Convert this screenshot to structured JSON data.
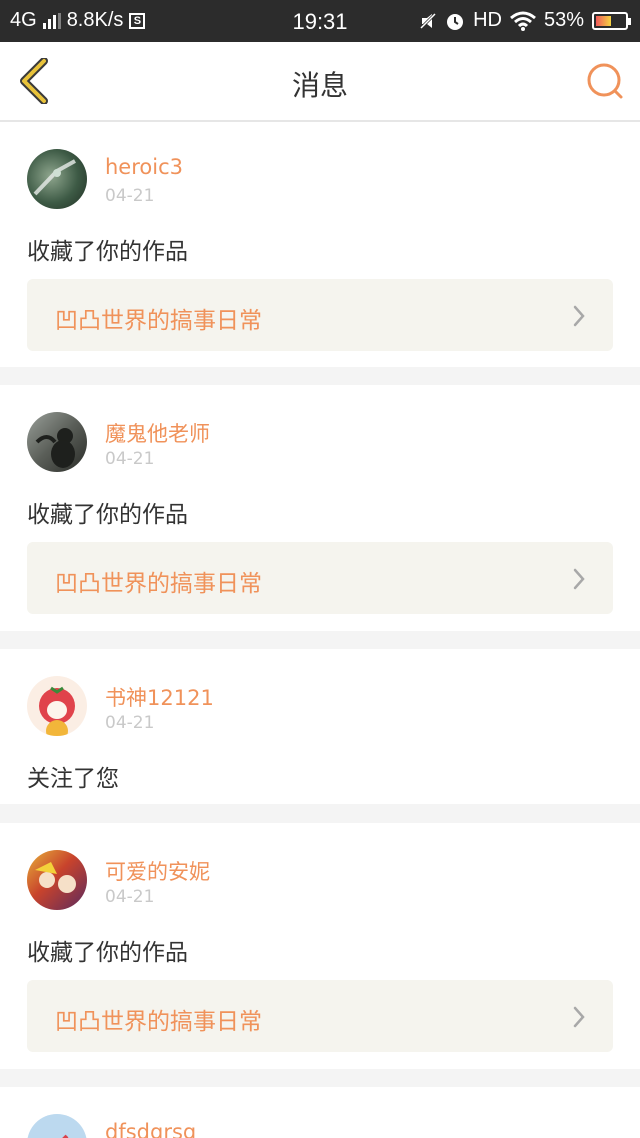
{
  "status_bar": {
    "network": "4G",
    "speed": "8.8K/s",
    "time": "19:31",
    "hd": "HD",
    "battery": "53%",
    "battery_level": 0.53
  },
  "header": {
    "title": "消息"
  },
  "messages": [
    {
      "user": "heroic3",
      "date": "04-21",
      "action": "收藏了你的作品",
      "work": "凹凸世界的搞事日常"
    },
    {
      "user": "魔鬼他老师",
      "date": "04-21",
      "action": "收藏了你的作品",
      "work": "凹凸世界的搞事日常"
    },
    {
      "user": "书神12121",
      "date": "04-21",
      "action": "关注了您"
    },
    {
      "user": "可爱的安妮",
      "date": "04-21",
      "action": "收藏了你的作品",
      "work": "凹凸世界的搞事日常"
    },
    {
      "user": "dfsdgrsg"
    }
  ],
  "colors": {
    "accent": "#f0925a",
    "back_icon": "#e8c23a",
    "text": "#333333",
    "date": "#c9c9c9",
    "work_bg": "#f5f4ee"
  }
}
